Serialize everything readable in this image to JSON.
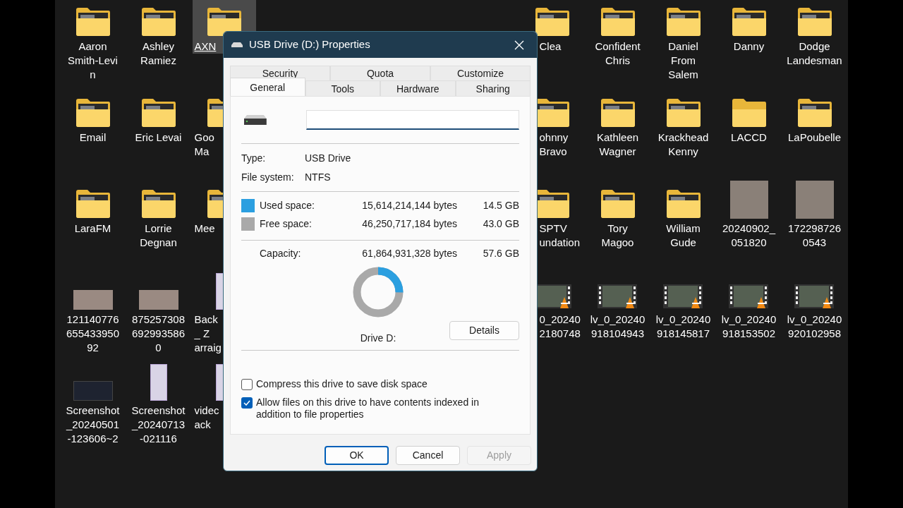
{
  "desktop": {
    "rows": [
      [
        {
          "kind": "folder",
          "label": [
            "Aaron",
            "Smith-Levi",
            "n"
          ],
          "selected": false
        },
        {
          "kind": "folder",
          "label": [
            "Ashley",
            "Ramiez"
          ],
          "selected": false
        },
        {
          "kind": "folder",
          "label": [
            "AXN"
          ],
          "selected": true
        },
        {
          "kind": "folder",
          "label": [
            "Clea"
          ],
          "selected": false
        },
        {
          "kind": "folder",
          "label": [
            "Confident",
            "Chris"
          ],
          "selected": false
        },
        {
          "kind": "folder",
          "label": [
            "Daniel",
            "From",
            "Salem"
          ],
          "selected": false
        },
        {
          "kind": "folder",
          "label": [
            "Danny"
          ],
          "selected": false
        },
        {
          "kind": "folder",
          "label": [
            "Dodge",
            "Landesman"
          ],
          "selected": false
        }
      ],
      [
        {
          "kind": "folder",
          "label": [
            "Email"
          ],
          "selected": false
        },
        {
          "kind": "folder",
          "label": [
            "Eric Levai"
          ],
          "selected": false
        },
        {
          "kind": "folder",
          "label": [
            "Goo",
            "Ma"
          ],
          "selected": false
        },
        {
          "kind": "folder",
          "label": [
            "ohnny",
            "Bravo"
          ],
          "selected": false
        },
        {
          "kind": "folder",
          "label": [
            "Kathleen",
            "Wagner"
          ],
          "selected": false
        },
        {
          "kind": "folder",
          "label": [
            "Krackhead",
            "Kenny"
          ],
          "selected": false
        },
        {
          "kind": "empty_folder",
          "label": [
            "LACCD"
          ],
          "selected": false
        },
        {
          "kind": "folder",
          "label": [
            "LaPoubelle"
          ],
          "selected": false
        }
      ],
      [
        {
          "kind": "folder",
          "label": [
            "LaraFM"
          ],
          "selected": false
        },
        {
          "kind": "folder",
          "label": [
            "Lorrie",
            "Degnan"
          ],
          "selected": false
        },
        {
          "kind": "folder",
          "label": [
            "Mee"
          ],
          "selected": false
        },
        {
          "kind": "folder",
          "label": [
            "SPTV",
            "undation"
          ],
          "selected": false
        },
        {
          "kind": "folder",
          "label": [
            "Tory",
            "Magoo"
          ],
          "selected": false
        },
        {
          "kind": "folder",
          "label": [
            "William",
            "Gude"
          ],
          "selected": false
        },
        {
          "kind": "photo",
          "label": [
            "20240902_",
            "051820"
          ],
          "selected": false
        },
        {
          "kind": "photo",
          "label": [
            "172298726",
            "0543"
          ],
          "selected": false
        }
      ],
      [
        {
          "kind": "wide_photo",
          "label": [
            "121140776",
            "655433950",
            "92"
          ],
          "selected": false
        },
        {
          "kind": "wide_photo",
          "label": [
            "875257308",
            "692993586",
            "0"
          ],
          "selected": false
        },
        {
          "kind": "screenshot",
          "label": [
            "Back",
            "_ Z",
            "arraig"
          ],
          "selected": false
        },
        {
          "kind": "video",
          "label": [
            "0_20240",
            "2180748"
          ],
          "selected": false
        },
        {
          "kind": "video",
          "label": [
            "lv_0_20240",
            "918104943"
          ],
          "selected": false
        },
        {
          "kind": "video",
          "label": [
            "lv_0_20240",
            "918145817"
          ],
          "selected": false
        },
        {
          "kind": "video",
          "label": [
            "lv_0_20240",
            "918153502"
          ],
          "selected": false
        },
        {
          "kind": "video",
          "label": [
            "lv_0_20240",
            "920102958"
          ],
          "selected": false
        }
      ],
      [
        {
          "kind": "wide_screenshot",
          "label": [
            "Screenshot",
            "_20240501",
            "-123606~2"
          ],
          "selected": false
        },
        {
          "kind": "screenshot",
          "label": [
            "Screenshot",
            "_20240713",
            "-021116"
          ],
          "selected": false
        },
        {
          "kind": "screenshot",
          "label": [
            "videc",
            "ack"
          ],
          "selected": false
        }
      ]
    ]
  },
  "dialog": {
    "title": "USB Drive (D:) Properties",
    "tab_rows": [
      [
        {
          "label": "Security",
          "selected": false
        },
        {
          "label": "Quota",
          "selected": false
        },
        {
          "label": "Customize",
          "selected": false
        }
      ],
      [
        {
          "label": "General",
          "selected": true
        },
        {
          "label": "Tools",
          "selected": false
        },
        {
          "label": "Hardware",
          "selected": false
        },
        {
          "label": "Sharing",
          "selected": false
        }
      ]
    ],
    "name_field": {
      "focused": true
    },
    "info": [
      {
        "label": "Type:",
        "value": "USB Drive"
      },
      {
        "label": "File system:",
        "value": "NTFS"
      }
    ],
    "space": [
      {
        "label": "Used space:",
        "bytes": "15,614,214,144 bytes",
        "size": "14.5 GB",
        "color": "#2b9fe0"
      },
      {
        "label": "Free space:",
        "bytes": "46,250,717,184 bytes",
        "size": "43.0 GB",
        "color": "#a9a9a9"
      }
    ],
    "capacity": {
      "label": "Capacity:",
      "bytes": "61,864,931,328 bytes",
      "size": "57.6 GB"
    },
    "usage": {
      "level": 0.252
    },
    "drive_label": "Drive D:",
    "details_button": "Details",
    "options": [
      {
        "label": "Compress this drive to save disk space",
        "checked": false
      },
      {
        "label": "Allow files on this drive to have contents indexed in addition to file properties",
        "checked": true
      }
    ],
    "buttons": [
      {
        "label": "OK",
        "kind": "default",
        "disabled": false
      },
      {
        "label": "Cancel",
        "kind": "normal",
        "disabled": false
      },
      {
        "label": "Apply",
        "kind": "normal",
        "disabled": true
      }
    ]
  }
}
